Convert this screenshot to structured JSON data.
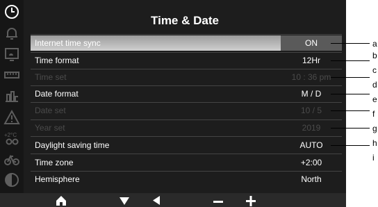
{
  "screen": {
    "title": "Time & Date",
    "rows": [
      {
        "label": "Internet time sync",
        "value": "ON",
        "state": "selected"
      },
      {
        "label": "Time format",
        "value": "12Hr",
        "state": "normal"
      },
      {
        "label": "Time set",
        "value": "10 : 36 pm",
        "state": "disabled"
      },
      {
        "label": "Date format",
        "value": "M / D",
        "state": "normal"
      },
      {
        "label": "Date set",
        "value": "10 / 5",
        "state": "disabled"
      },
      {
        "label": "Year set",
        "value": "2019",
        "state": "disabled"
      },
      {
        "label": "Daylight saving time",
        "value": "AUTO",
        "state": "normal"
      },
      {
        "label": "Time zone",
        "value": "+2:00",
        "state": "normal"
      },
      {
        "label": "Hemisphere",
        "value": "North",
        "state": "normal"
      }
    ]
  },
  "sidebar_icons": [
    "clock-icon",
    "bell-icon",
    "forecast-icon",
    "sensor-icon",
    "chart-icon",
    "alert-icon",
    "temperature-icon",
    "bike-icon",
    "moon-phase-icon"
  ],
  "bottom_bar_icons": [
    "home-icon",
    "down-arrow-icon",
    "left-arrow-icon",
    "minus-icon",
    "plus-icon"
  ],
  "callouts": [
    "a",
    "b",
    "c",
    "d",
    "e",
    "f",
    "g",
    "h",
    "i"
  ],
  "colors": {
    "selected_value_bg": "#5a5a5a",
    "disabled_text": "#4b4b4b",
    "screen_bg": "#1d1d1d"
  }
}
